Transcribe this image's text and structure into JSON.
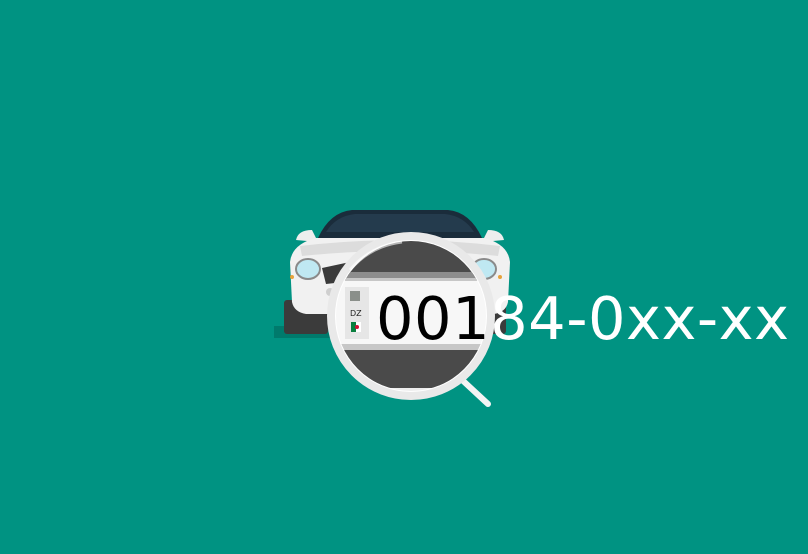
{
  "plate": {
    "country_code": "DZ",
    "number_dark_part": "001",
    "number_light_part": "84-0xx-xx"
  },
  "colors": {
    "background": "#009382",
    "car_body": "#f1f1f1",
    "windshield": "#1a2c3b",
    "magnifier_ring": "#f4f4f4",
    "flag_green": "#0a7f3f",
    "flag_red": "#d21034"
  },
  "icons": {
    "car": "car-front-icon",
    "magnifier": "magnifying-glass-icon",
    "flag": "algeria-flag-icon"
  }
}
